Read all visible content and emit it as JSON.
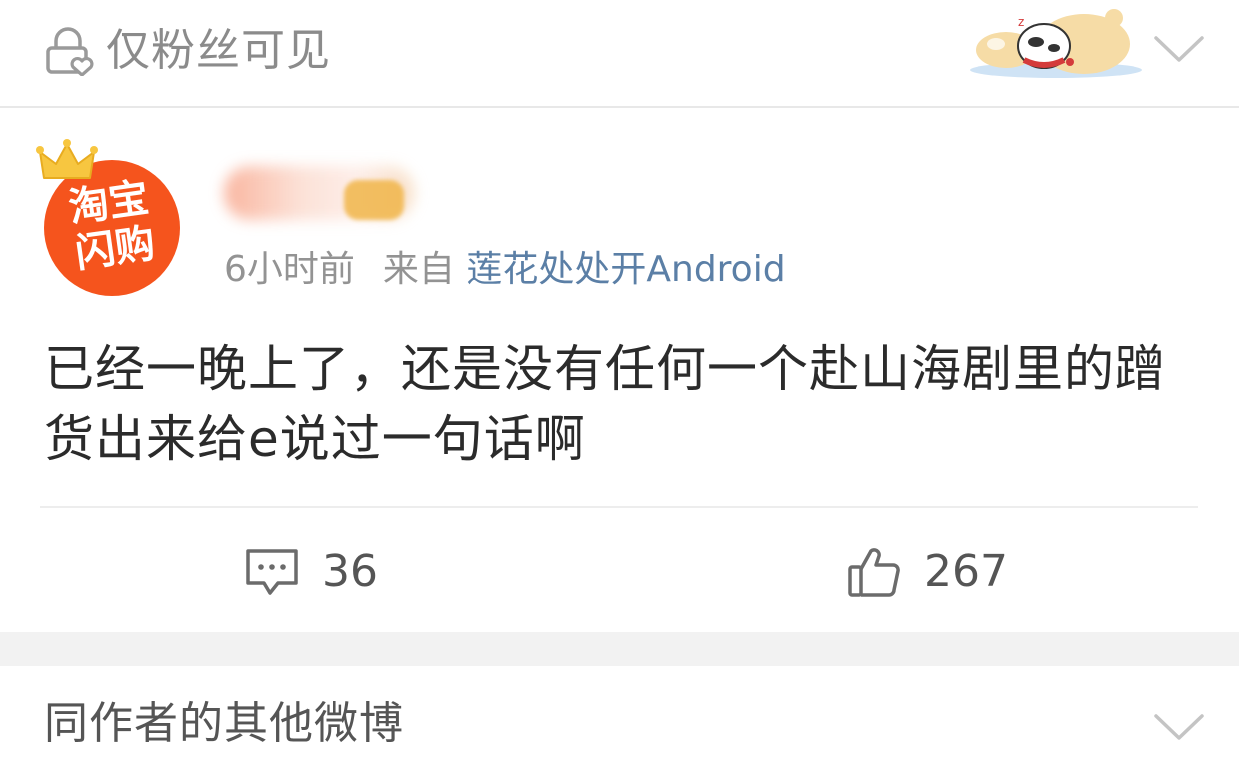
{
  "visibility": {
    "label": "仅粉丝可见",
    "icon": "lock-heart-icon"
  },
  "post": {
    "avatar_text_line1": "淘宝",
    "avatar_text_line2": "闪购",
    "avatar_color": "#f5541d",
    "time": "6小时前",
    "from_label": "来自",
    "source": "莲花处处开Android",
    "source_color": "#5b7fa6",
    "text": "已经一晚上了，还是没有任何一个赴山海剧里的蹭货出来给e说过一句话啊"
  },
  "actions": {
    "comments": "36",
    "likes": "267"
  },
  "more": {
    "label": "同作者的其他微博"
  }
}
